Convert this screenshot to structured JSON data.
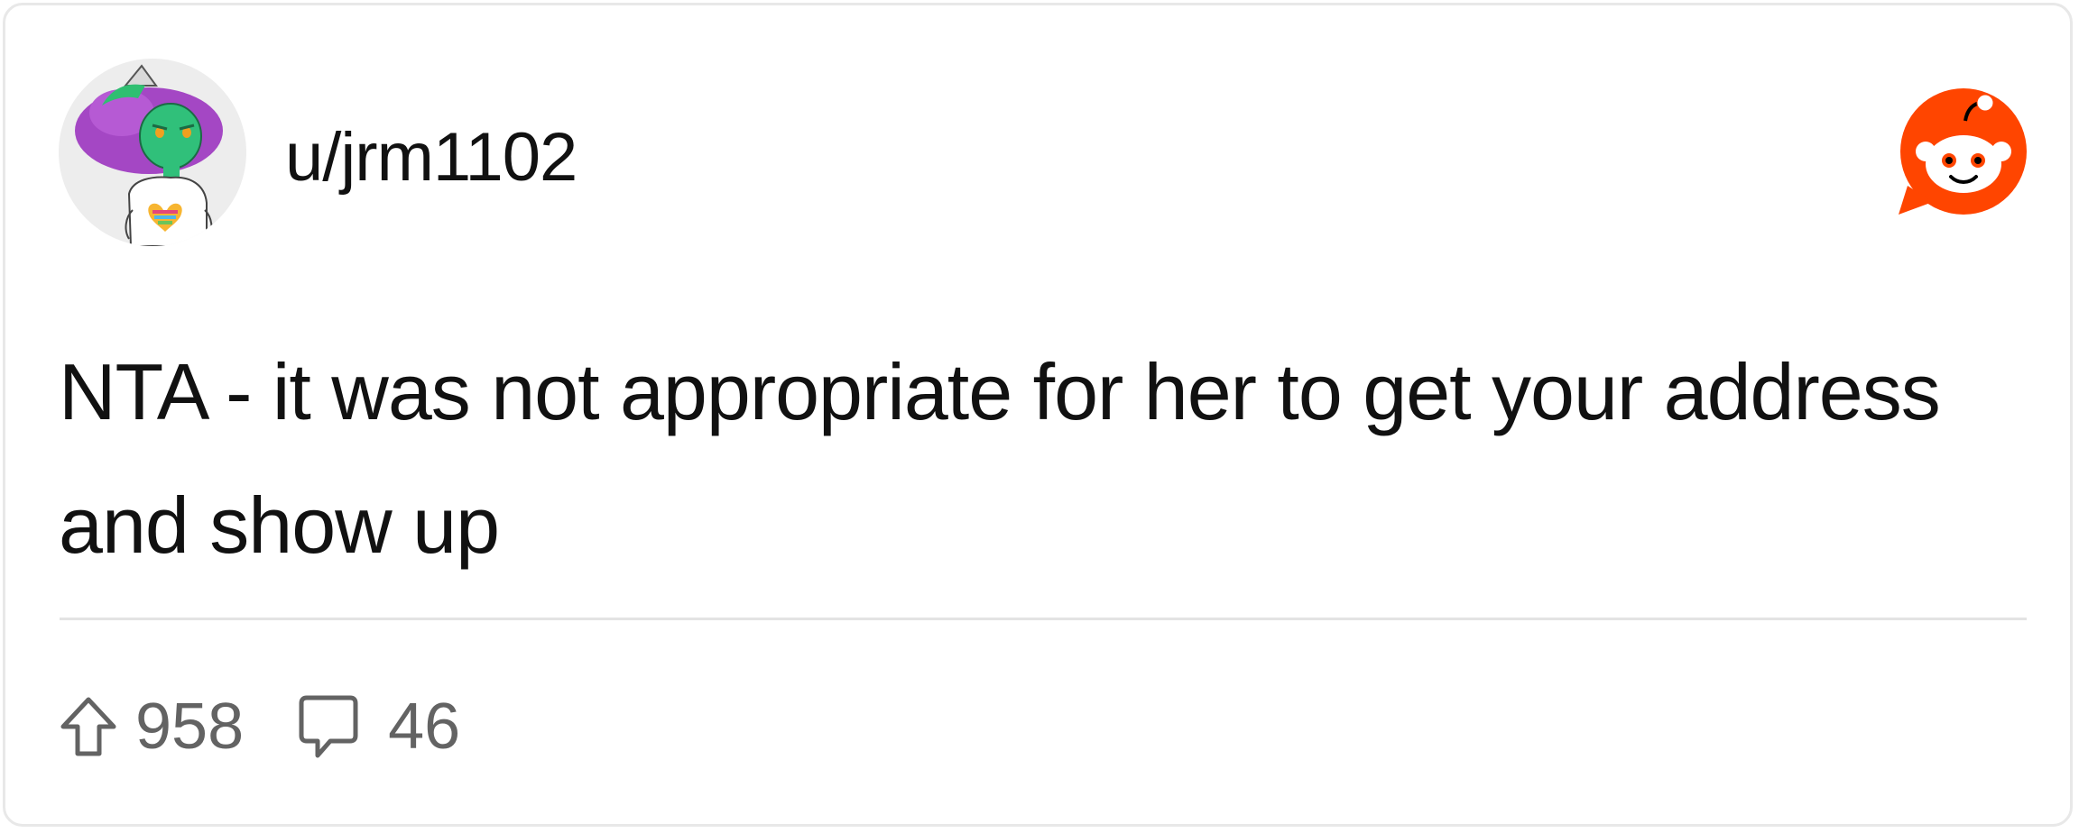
{
  "author": {
    "username": "u/jrm1102"
  },
  "post": {
    "body": "NTA - it was not appropriate for her to get your address and show up"
  },
  "stats": {
    "upvotes": "958",
    "comments": "46"
  },
  "icons": {
    "brand": "reddit-snoo-logo",
    "upvote": "arrow-up-icon",
    "comments": "speech-bubble-icon"
  },
  "colors": {
    "brand": "#FF4500",
    "text": "#111111",
    "muted": "#636363",
    "divider": "#E3E3E3"
  }
}
